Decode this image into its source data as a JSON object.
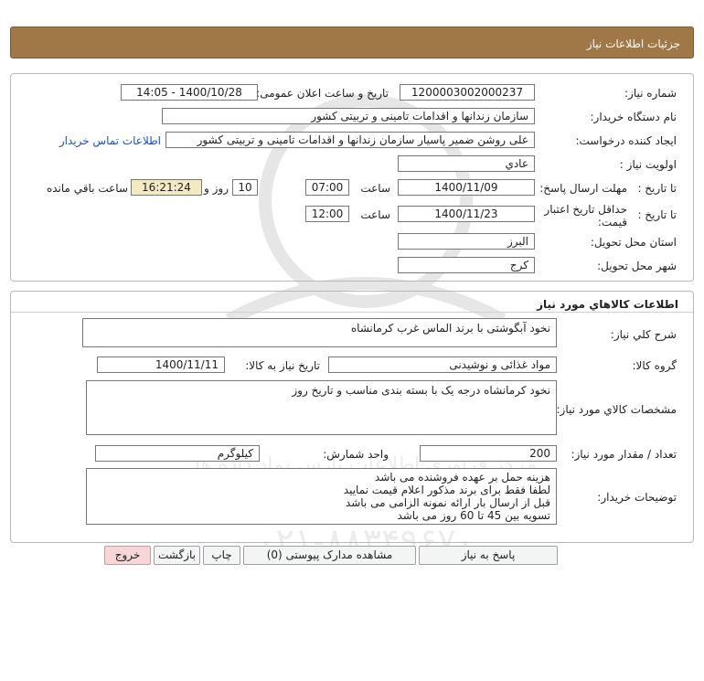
{
  "header": {
    "title": "جزئیات اطلاعات نیاز"
  },
  "need_info": {
    "need_number": {
      "label": "شماره نیاز:",
      "value": "1200003002000237"
    },
    "announce_datetime": {
      "label": "تاریخ و ساعت اعلان عمومی:",
      "value": "1400/10/28 - 14:05"
    },
    "buyer_org": {
      "label": "نام دستگاه خریدار:",
      "value": "سازمان زندانها و اقدامات تامینی و تربیتی کشور"
    },
    "requester": {
      "label": "ایجاد کننده درخواست:",
      "value": "علی روشن ضمیر پاسیار سازمان زندانها و اقدامات تامینی و تربیتی کشور"
    },
    "contact_link": "اطلاعات تماس خریدار",
    "priority": {
      "label": "اولویت نیاز :",
      "value": "عادي"
    },
    "reply_deadline": {
      "label": "مهلت ارسال پاسخ:",
      "to_date_label": "تا تاریخ :",
      "date": "1400/11/09",
      "time_label": "ساعت",
      "time": "07:00",
      "days": "10",
      "days_label": "روز و",
      "remaining": "16:21:24",
      "remaining_label": "ساعت باقي مانده"
    },
    "price_validity": {
      "label": "حداقل تاریخ اعتبار قیمت:",
      "to_date_label": "تا تاریخ :",
      "date": "1400/11/23",
      "time_label": "ساعت",
      "time": "12:00"
    },
    "province": {
      "label": "استان محل تحویل:",
      "value": "البرز"
    },
    "city": {
      "label": "شهر محل تحویل:",
      "value": "کرج"
    }
  },
  "goods": {
    "section_title": "اطلاعات کالاهاي مورد نياز",
    "general_desc": {
      "label": "شرح کلي نياز:",
      "value": "نخود آبگوشتی با برند الماس غرب کرمانشاه"
    },
    "goods_group": {
      "label": "گروه کالا:",
      "value": "مواد غذائی و نوشیدنی"
    },
    "need_date": {
      "label": "تاریخ نیاز به کالا:",
      "value": "1400/11/11"
    },
    "specs": {
      "label": "مشخصات کالاي مورد نياز:",
      "value": "نخود کرمانشاه درجه یک با بسته بندی مناسب و تاریخ روز"
    },
    "quantity": {
      "label": "تعداد / مقدار مورد نیاز:",
      "value": "200"
    },
    "unit": {
      "label": "واحد شمارش:",
      "value": "کیلوگرم"
    },
    "buyer_notes": {
      "label": "توضیحات خریدار:",
      "lines": [
        "هزینه حمل بر عهده فروشنده می باشد",
        "لطفا فقط برای برند مذکور اعلام قیمت نمایید",
        "قبل از ارسال بار ارائه نمونه الزامی می باشد",
        "تسویه بین 45 تا 60 روز می باشد"
      ]
    }
  },
  "buttons": {
    "reply": "پاسخ به نیاز",
    "view_docs": "مشاهده مدارک پیوستی (0)",
    "print": "چاپ",
    "back": "بازگشت",
    "exit": "خروج"
  },
  "watermark": {
    "brand": "ParsNamadData",
    "line1": "مرکز فراوری اطلاعات پارس نماد داده ها",
    "line2": "پایگاه اطلاع رسانی مناقصه و مزایده",
    "phone": "۰۲۱-۸۸۳۴۹۶۷۰"
  },
  "colors": {
    "header_bg": "#a07848",
    "link": "#1a52b6",
    "highlight": "#f3eac4",
    "exit_bg": "#f6d6d6"
  }
}
